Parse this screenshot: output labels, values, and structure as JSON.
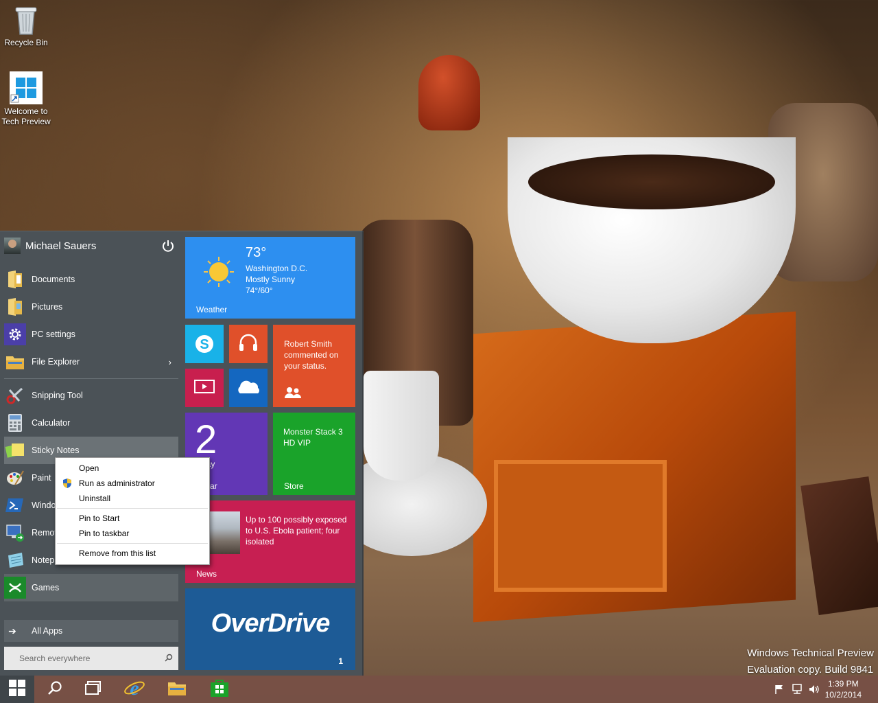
{
  "desktop": {
    "icons": [
      {
        "label": "Recycle Bin"
      },
      {
        "label_line1": "Welcome to",
        "label_line2": "Tech Preview"
      }
    ],
    "watermark_line1": "Windows Technical Preview",
    "watermark_line2": "Evaluation copy. Build 9841"
  },
  "start_menu": {
    "user_name": "Michael Sauers",
    "places": [
      {
        "label": "Documents",
        "icon": "folder-documents-icon"
      },
      {
        "label": "Pictures",
        "icon": "folder-pictures-icon"
      },
      {
        "label": "PC settings",
        "icon": "gear-icon"
      },
      {
        "label": "File Explorer",
        "icon": "folder-icon",
        "chevron": "›"
      }
    ],
    "apps": [
      {
        "label": "Snipping Tool",
        "icon": "scissors-icon"
      },
      {
        "label": "Calculator",
        "icon": "calculator-icon"
      },
      {
        "label": "Sticky Notes",
        "icon": "sticky-notes-icon"
      },
      {
        "label": "Paint",
        "icon": "palette-icon"
      },
      {
        "label": "Windo",
        "icon": "powershell-icon"
      },
      {
        "label": "Remot",
        "icon": "remote-desktop-icon"
      },
      {
        "label": "Notep",
        "icon": "notepad-icon"
      },
      {
        "label": "Games",
        "icon": "gamepad-icon"
      }
    ],
    "all_apps": "All Apps",
    "search_placeholder": "Search everywhere"
  },
  "tiles": {
    "weather": {
      "temp": "73°",
      "city": "Washington D.C.",
      "cond": "Mostly Sunny",
      "range": "74°/60°",
      "label": "Weather",
      "color": "#2d8ff0"
    },
    "social": {
      "text": "Robert Smith commented on your status.",
      "color": "#e0502a"
    },
    "calendar": {
      "day": "2",
      "weekday": "rsday",
      "label": "endar",
      "color": "#6237b5"
    },
    "store": {
      "title_line1": "Monster Stack 3",
      "title_line2": "HD VIP",
      "label": "Store",
      "color": "#1aa32a"
    },
    "news": {
      "headline": "Up to 100 possibly exposed to U.S. Ebola patient; four isolated",
      "label": "News",
      "color": "#c71f52"
    },
    "overdrive": {
      "logo": "OverDrive",
      "badge": "1",
      "color": "#1d5b96"
    }
  },
  "context_menu": {
    "open": "Open",
    "run_admin": "Run as administrator",
    "uninstall": "Uninstall",
    "pin_start": "Pin to Start",
    "pin_taskbar": "Pin to taskbar",
    "remove": "Remove from this list"
  },
  "taskbar": {
    "time": "1:39 PM",
    "date": "10/2/2014"
  }
}
